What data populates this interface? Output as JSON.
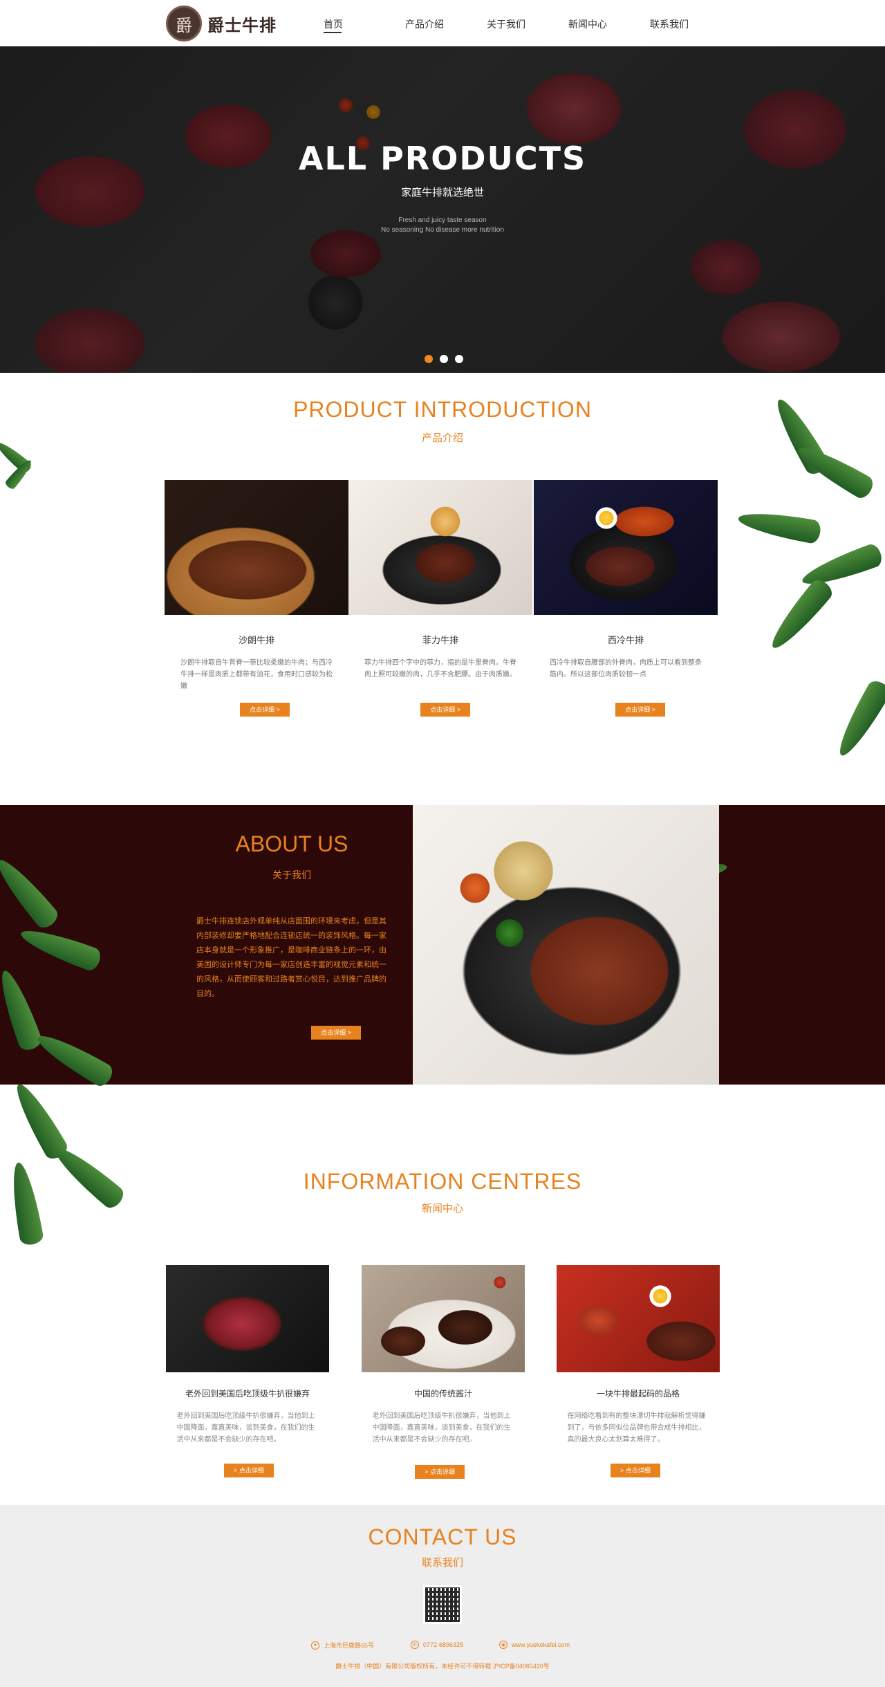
{
  "header": {
    "logo_glyph": "爵",
    "logo_text": "爵士牛排",
    "nav": [
      "首页",
      "产品介绍",
      "关于我们",
      "新闻中心",
      "联系我们"
    ]
  },
  "banner": {
    "title": "ALL PRODUCTS",
    "subtitle": "家庭牛排就选绝世",
    "small_line_1": "Fresh and juicy taste season",
    "small_line_2": "No seasoning No disease more nutrition"
  },
  "products": {
    "title_en": "PRODUCT INTRODUCTION",
    "title_cn": "产品介绍",
    "items": [
      {
        "name": "沙朗牛排",
        "desc": "沙朗牛排取自牛背脊一带比较柔嫩的牛肉；与西冷牛排一样是肉质上都带有油花，食用时口感较为松嫩",
        "button": "点击详细 >"
      },
      {
        "name": "菲力牛排",
        "desc": "菲力牛排四个字中的菲力，指的是牛里脊肉。牛脊肉上照可较嫩的肉，几乎不含肥膘。由于肉质嫩。",
        "button": "点击详细 >"
      },
      {
        "name": "西冷牛排",
        "desc": "西冷牛排取自腰部的外脊肉，肉质上可以看到整条筋内。所以这部位肉质较韧一点",
        "button": "点击详细 >"
      }
    ]
  },
  "about": {
    "title_en": "ABOUT US",
    "title_cn": "关于我们",
    "text": "爵士牛排连锁店外观单纯从店面围的环境来考虑，但是其内部装修却要严格地配合连锁店统一的装饰风格。每一家店本身就是一个形象推广，是咖啡商业链条上的一环，由美国的设计师专门为每一家店创造丰富的视觉元素和统一的风格，从而使顾客和过路者赏心悦目，达到推广品牌的目的。",
    "button": "点击详细 >"
  },
  "news": {
    "title_en": "INFORMATION CENTRES",
    "title_cn": "新闻中心",
    "items": [
      {
        "title": "老外回到美国后吃顶级牛扒很嫌弃",
        "desc": "老外回到美国后吃顶级牛扒很嫌弃，当他到上中国降面，嘉直美味，谈到美食，在我们的生活中从来都是不会缺少的存在吧。",
        "button": "> 点击详细"
      },
      {
        "title": "中国的传统酱汁",
        "desc": "老外回到美国后吃顶级牛扒很嫌弃，当他到上中国降面，嘉直美味，谈到美食，在我们的生活中从来都是不会缺少的存在吧。",
        "button": "> 点击详细"
      },
      {
        "title": "一块牛排最起码的品格",
        "desc": "在网络吃看到有的整块漂切牛排就解析觉得嫌到了，与依多同似位品牌也带合成牛排相比，真的最大良心太划算太难得了。",
        "button": "> 点击详细"
      }
    ]
  },
  "contact": {
    "title_en": "CONTACT US",
    "title_cn": "联系我们",
    "address": "上海市巨鹿路65号",
    "phone": "0772-6896325",
    "website": "www.yuekekafei.com",
    "copyright": "爵士牛排（中国）有限公司版权所有，未经许可不得转载    沪ICP备04065420号"
  },
  "colors": {
    "accent": "#e8821e",
    "about_bg": "#2c0808",
    "contact_bg": "#eeeeee"
  }
}
